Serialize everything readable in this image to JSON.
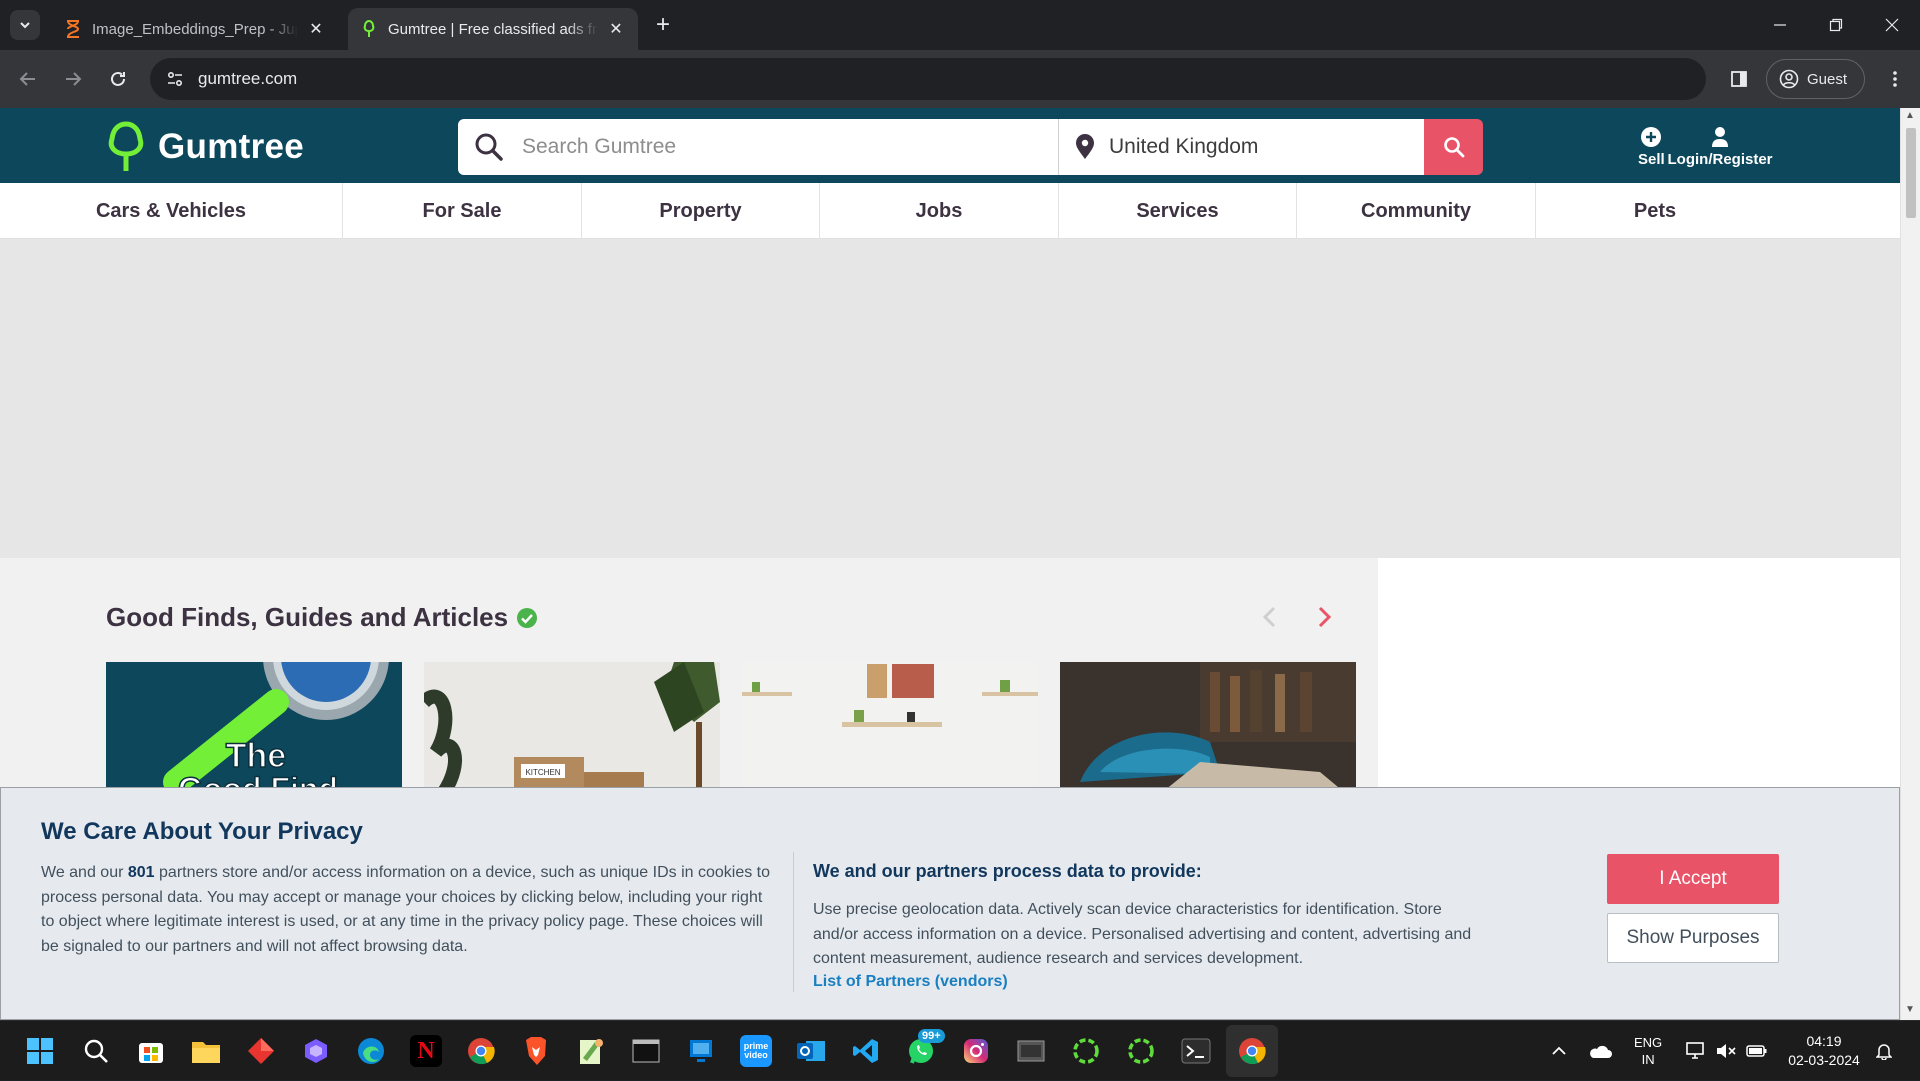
{
  "browser": {
    "tabs": [
      {
        "title": "Image_Embeddings_Prep - Jupyter",
        "active": false
      },
      {
        "title": "Gumtree | Free classified ads from",
        "active": true
      }
    ],
    "url": "gumtree.com",
    "profile_label": "Guest"
  },
  "header": {
    "logo_text": "Gumtree",
    "search_placeholder": "Search Gumtree",
    "location_value": "United Kingdom",
    "sell_label": "Sell",
    "login_label": "Login/Register",
    "colors": {
      "header_bg": "#0d475c",
      "accent": "#e85367",
      "logo_green": "#72ef36"
    }
  },
  "categories": [
    "Cars & Vehicles",
    "For Sale",
    "Property",
    "Jobs",
    "Services",
    "Community",
    "Pets"
  ],
  "finds": {
    "title": "Good Finds, Guides and Articles",
    "cards": [
      {
        "text_line1": "The",
        "text_line2": "Good Find"
      },
      {
        "box_label": "KITCHEN"
      },
      {},
      {}
    ]
  },
  "privacy": {
    "title": "We Care About Your Privacy",
    "text_before": "We and our ",
    "partner_count": "801",
    "text_after": " partners store and/or access information on a device, such as unique IDs in cookies to process personal data. You may accept or manage your choices by clicking below, including your right to object where legitimate interest is used, or at any time in the privacy policy page. These choices will be signaled to our partners and will not affect browsing data.",
    "subtitle": "We and our partners process data to provide:",
    "subtext": "Use precise geolocation data. Actively scan device characteristics for identification. Store and/or access information on a device. Personalised advertising and content, advertising and content measurement, audience research and services development.",
    "partners_link": "List of Partners (vendors)",
    "accept_label": "I Accept",
    "purposes_label": "Show Purposes"
  },
  "taskbar": {
    "whatsapp_badge": "99+",
    "lang_line1": "ENG",
    "lang_line2": "IN",
    "time": "04:19",
    "date": "02-03-2024"
  }
}
